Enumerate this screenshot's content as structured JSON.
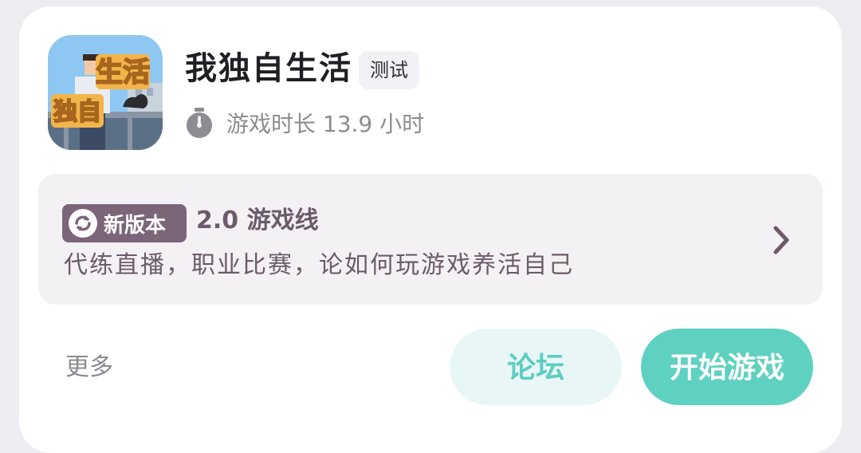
{
  "game": {
    "title": "我独自生活",
    "tag": "测试",
    "playtime_label": "游戏时长 13.9 小时",
    "icon_text_top": "生活",
    "icon_text_bottom": "独自"
  },
  "version": {
    "badge": "新版本",
    "title": "2.0 游戏线",
    "description": "代练直播，职业比赛，论如何玩游戏养活自己"
  },
  "actions": {
    "more": "更多",
    "forum": "论坛",
    "start": "开始游戏"
  },
  "colors": {
    "accent": "#5fd1c1",
    "accent_light": "#e8f7f6",
    "version_bg": "#f4f1f4",
    "version_text": "#6c5b6b",
    "badge_bg": "#7b6679"
  },
  "icons": {
    "stopwatch": "stopwatch-icon",
    "refresh": "refresh-icon",
    "chevron": "chevron-right-icon"
  }
}
